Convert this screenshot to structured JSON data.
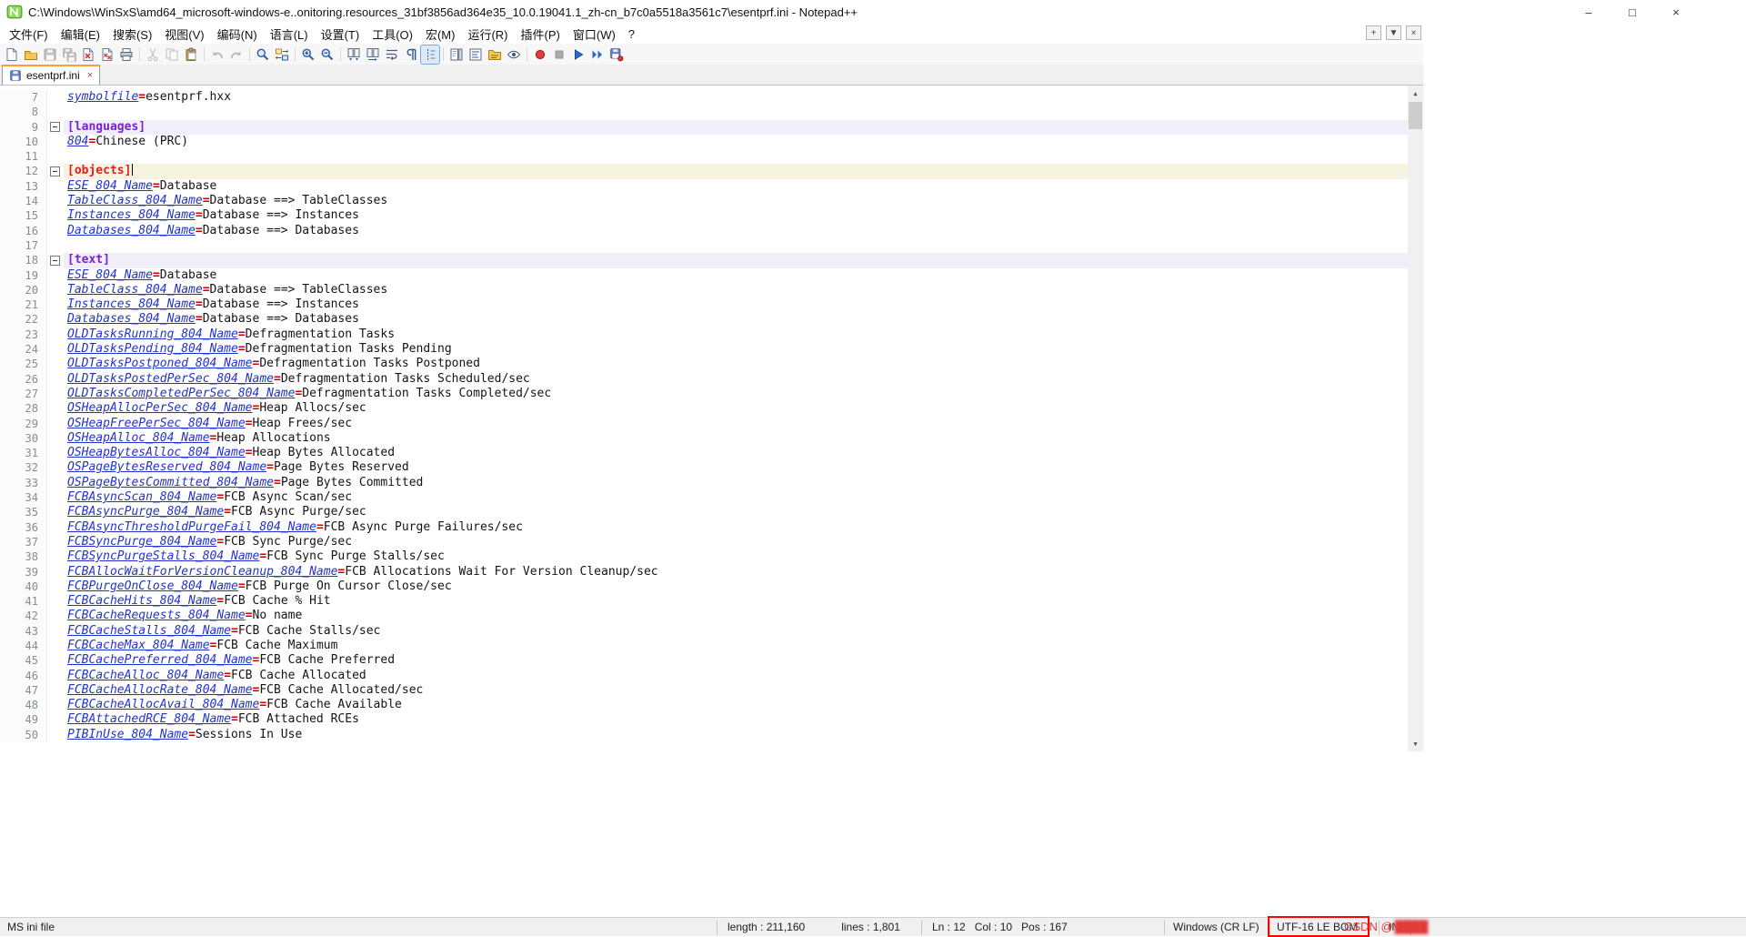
{
  "window": {
    "title": "C:\\Windows\\WinSxS\\amd64_microsoft-windows-e..onitoring.resources_31bf3856ad364e35_10.0.19041.1_zh-cn_b7c0a5518a3561c7\\esentprf.ini - Notepad++",
    "controls": {
      "minimize": "–",
      "maximize": "□",
      "close": "×"
    }
  },
  "menu": {
    "items": [
      {
        "key": "file",
        "label": "文件(F)"
      },
      {
        "key": "edit",
        "label": "编辑(E)"
      },
      {
        "key": "search",
        "label": "搜索(S)"
      },
      {
        "key": "view",
        "label": "视图(V)"
      },
      {
        "key": "encoding",
        "label": "编码(N)"
      },
      {
        "key": "language",
        "label": "语言(L)"
      },
      {
        "key": "settings",
        "label": "设置(T)"
      },
      {
        "key": "tools",
        "label": "工具(O)"
      },
      {
        "key": "macro",
        "label": "宏(M)"
      },
      {
        "key": "run",
        "label": "运行(R)"
      },
      {
        "key": "plugins",
        "label": "插件(P)"
      },
      {
        "key": "window",
        "label": "窗口(W)"
      },
      {
        "key": "help",
        "label": "?"
      }
    ],
    "extras": [
      {
        "name": "new-tab-button",
        "glyph": "+"
      },
      {
        "name": "tab-list-dropdown",
        "glyph": "▼"
      },
      {
        "name": "extra-close-button",
        "glyph": "×"
      }
    ]
  },
  "toolbar": {
    "items": [
      {
        "icon": "new-file"
      },
      {
        "icon": "open-folder"
      },
      {
        "icon": "save",
        "state": "disabled"
      },
      {
        "icon": "save-all",
        "state": "disabled"
      },
      {
        "icon": "close-file"
      },
      {
        "icon": "close-all"
      },
      {
        "icon": "print"
      },
      {
        "sep": true
      },
      {
        "icon": "cut",
        "state": "disabled"
      },
      {
        "icon": "copy",
        "state": "disabled"
      },
      {
        "icon": "paste"
      },
      {
        "sep": true
      },
      {
        "icon": "undo",
        "state": "disabled"
      },
      {
        "icon": "redo",
        "state": "disabled"
      },
      {
        "sep": true
      },
      {
        "icon": "find"
      },
      {
        "icon": "replace"
      },
      {
        "sep": true
      },
      {
        "icon": "zoom-in"
      },
      {
        "icon": "zoom-out"
      },
      {
        "sep": true
      },
      {
        "icon": "sync-vertical"
      },
      {
        "icon": "sync-horizontal"
      },
      {
        "icon": "word-wrap"
      },
      {
        "icon": "show-all-characters"
      },
      {
        "icon": "indent-guide",
        "state": "pressed"
      },
      {
        "sep": true
      },
      {
        "icon": "doc-map"
      },
      {
        "icon": "function-list"
      },
      {
        "icon": "folder-workspace"
      },
      {
        "icon": "monitoring"
      },
      {
        "sep": true
      },
      {
        "icon": "record-macro"
      },
      {
        "icon": "stop-macro",
        "state": "disabled"
      },
      {
        "icon": "play-macro"
      },
      {
        "icon": "run-macro-multiple"
      },
      {
        "icon": "save-macro"
      }
    ]
  },
  "tabs": [
    {
      "label": "esentprf.ini",
      "active": true,
      "close_glyph": "×"
    }
  ],
  "scrollbar": {
    "up_glyph": "▲",
    "down_glyph": "▼"
  },
  "editor": {
    "equals_sign": "=",
    "lines": [
      {
        "n": 7,
        "t": "kv",
        "k": "symbolfile",
        "v": "esentprf.hxx"
      },
      {
        "n": 8,
        "t": "blank"
      },
      {
        "n": 9,
        "t": "sec",
        "s": "[languages]",
        "fold": true
      },
      {
        "n": 10,
        "t": "kv",
        "k": "804",
        "v": "Chinese (PRC)"
      },
      {
        "n": 11,
        "t": "blank"
      },
      {
        "n": 12,
        "t": "sec",
        "s": "[objects]",
        "fold": true,
        "red": true,
        "cur": true
      },
      {
        "n": 13,
        "t": "kv",
        "k": "ESE_804_Name",
        "v": "Database"
      },
      {
        "n": 14,
        "t": "kv",
        "k": "TableClass_804_Name",
        "v": "Database ==> TableClasses"
      },
      {
        "n": 15,
        "t": "kv",
        "k": "Instances_804_Name",
        "v": "Database ==> Instances"
      },
      {
        "n": 16,
        "t": "kv",
        "k": "Databases_804_Name",
        "v": "Database ==> Databases"
      },
      {
        "n": 17,
        "t": "blank"
      },
      {
        "n": 18,
        "t": "sec",
        "s": "[text]",
        "fold": true
      },
      {
        "n": 19,
        "t": "kv",
        "k": "ESE_804_Name",
        "v": "Database"
      },
      {
        "n": 20,
        "t": "kv",
        "k": "TableClass_804_Name",
        "v": "Database ==> TableClasses"
      },
      {
        "n": 21,
        "t": "kv",
        "k": "Instances_804_Name",
        "v": "Database ==> Instances"
      },
      {
        "n": 22,
        "t": "kv",
        "k": "Databases_804_Name",
        "v": "Database ==> Databases"
      },
      {
        "n": 23,
        "t": "kv",
        "k": "OLDTasksRunning_804_Name",
        "v": "Defragmentation Tasks"
      },
      {
        "n": 24,
        "t": "kv",
        "k": "OLDTasksPending_804_Name",
        "v": "Defragmentation Tasks Pending"
      },
      {
        "n": 25,
        "t": "kv",
        "k": "OLDTasksPostponed_804_Name",
        "v": "Defragmentation Tasks Postponed"
      },
      {
        "n": 26,
        "t": "kv",
        "k": "OLDTasksPostedPerSec_804_Name",
        "v": "Defragmentation Tasks Scheduled/sec"
      },
      {
        "n": 27,
        "t": "kv",
        "k": "OLDTasksCompletedPerSec_804_Name",
        "v": "Defragmentation Tasks Completed/sec"
      },
      {
        "n": 28,
        "t": "kv",
        "k": "OSHeapAllocPerSec_804_Name",
        "v": "Heap Allocs/sec"
      },
      {
        "n": 29,
        "t": "kv",
        "k": "OSHeapFreePerSec_804_Name",
        "v": "Heap Frees/sec"
      },
      {
        "n": 30,
        "t": "kv",
        "k": "OSHeapAlloc_804_Name",
        "v": "Heap Allocations"
      },
      {
        "n": 31,
        "t": "kv",
        "k": "OSHeapBytesAlloc_804_Name",
        "v": "Heap Bytes Allocated"
      },
      {
        "n": 32,
        "t": "kv",
        "k": "OSPageBytesReserved_804_Name",
        "v": "Page Bytes Reserved"
      },
      {
        "n": 33,
        "t": "kv",
        "k": "OSPageBytesCommitted_804_Name",
        "v": "Page Bytes Committed"
      },
      {
        "n": 34,
        "t": "kv",
        "k": "FCBAsyncScan_804_Name",
        "v": "FCB Async Scan/sec"
      },
      {
        "n": 35,
        "t": "kv",
        "k": "FCBAsyncPurge_804_Name",
        "v": "FCB Async Purge/sec"
      },
      {
        "n": 36,
        "t": "kv",
        "k": "FCBAsyncThresholdPurgeFail_804_Name",
        "v": "FCB Async Purge Failures/sec"
      },
      {
        "n": 37,
        "t": "kv",
        "k": "FCBSyncPurge_804_Name",
        "v": "FCB Sync Purge/sec"
      },
      {
        "n": 38,
        "t": "kv",
        "k": "FCBSyncPurgeStalls_804_Name",
        "v": "FCB Sync Purge Stalls/sec"
      },
      {
        "n": 39,
        "t": "kv",
        "k": "FCBAllocWaitForVersionCleanup_804_Name",
        "v": "FCB Allocations Wait For Version Cleanup/sec"
      },
      {
        "n": 40,
        "t": "kv",
        "k": "FCBPurgeOnClose_804_Name",
        "v": "FCB Purge On Cursor Close/sec"
      },
      {
        "n": 41,
        "t": "kv",
        "k": "FCBCacheHits_804_Name",
        "v": "FCB Cache % Hit"
      },
      {
        "n": 42,
        "t": "kv",
        "k": "FCBCacheRequests_804_Name",
        "v": "No name"
      },
      {
        "n": 43,
        "t": "kv",
        "k": "FCBCacheStalls_804_Name",
        "v": "FCB Cache Stalls/sec"
      },
      {
        "n": 44,
        "t": "kv",
        "k": "FCBCacheMax_804_Name",
        "v": "FCB Cache Maximum"
      },
      {
        "n": 45,
        "t": "kv",
        "k": "FCBCachePreferred_804_Name",
        "v": "FCB Cache Preferred"
      },
      {
        "n": 46,
        "t": "kv",
        "k": "FCBCacheAlloc_804_Name",
        "v": "FCB Cache Allocated"
      },
      {
        "n": 47,
        "t": "kv",
        "k": "FCBCacheAllocRate_804_Name",
        "v": "FCB Cache Allocated/sec"
      },
      {
        "n": 48,
        "t": "kv",
        "k": "FCBCacheAllocAvail_804_Name",
        "v": "FCB Cache Available"
      },
      {
        "n": 49,
        "t": "kv",
        "k": "FCBAttachedRCE_804_Name",
        "v": "FCB Attached RCEs"
      },
      {
        "n": 50,
        "t": "kv",
        "k": "PIBInUse_804_Name",
        "v": "Sessions In Use"
      }
    ]
  },
  "statusbar": {
    "doc_type": "MS ini file",
    "length_label": "length : 211,160",
    "lines_label": "lines : 1,801",
    "position": "Ln : 12   Col : 10   Pos : 167",
    "eol": "Windows (CR LF)",
    "encoding": "UTF-16 LE BOM",
    "mode": "INS"
  },
  "watermark": {
    "prefix": "CSDN @",
    "suffix": "████"
  },
  "colors": {
    "tab_accent": "#FCA22C",
    "ini_key": "#2233CC",
    "equals_sign": "#CC0000",
    "section_header": "#7A22CC",
    "section_header_active": "#E02020",
    "section_line_bg": "#EFEEF9",
    "current_line_bg": "#F6F3E0",
    "annotation_red": "#FF0000",
    "watermark_red": "#E23A3A"
  }
}
